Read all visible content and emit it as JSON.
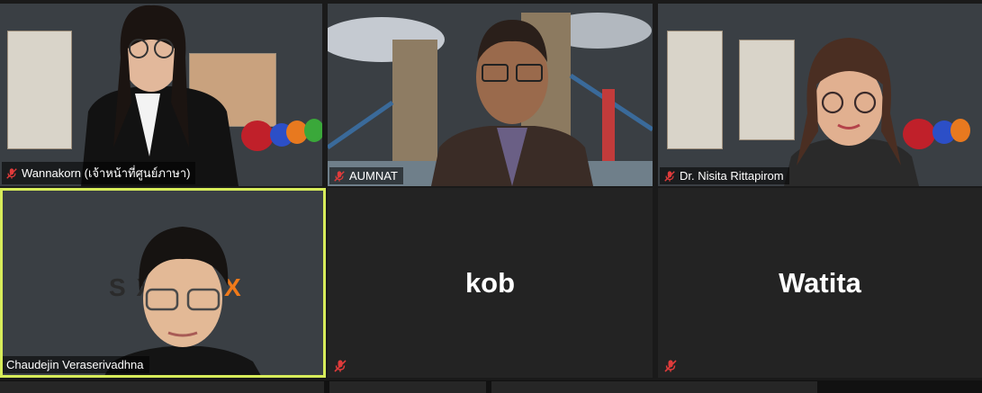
{
  "participants": [
    {
      "name": "Wannakorn (เจ้าหน้าที่ศูนย์ภาษา)",
      "muted": true,
      "video": true
    },
    {
      "name": "AUMNAT",
      "muted": true,
      "video": true
    },
    {
      "name": "Dr. Nisita Rittapirom",
      "muted": true,
      "video": true
    },
    {
      "name": "Chaudejin Veraserivadhna",
      "muted": false,
      "video": true,
      "active_speaker": true
    },
    {
      "name": "kob",
      "muted": true,
      "video": false
    },
    {
      "name": "Watita",
      "muted": true,
      "video": false
    }
  ],
  "colors": {
    "active_border": "#d7ec5a",
    "tile_bg": "#232323",
    "mute_icon": "#e03b3b",
    "page_bg": "#1a1a1a"
  },
  "icons": {
    "mute": "microphone-muted-icon"
  },
  "background_text": {
    "office_wall_logo": "S    X X"
  }
}
